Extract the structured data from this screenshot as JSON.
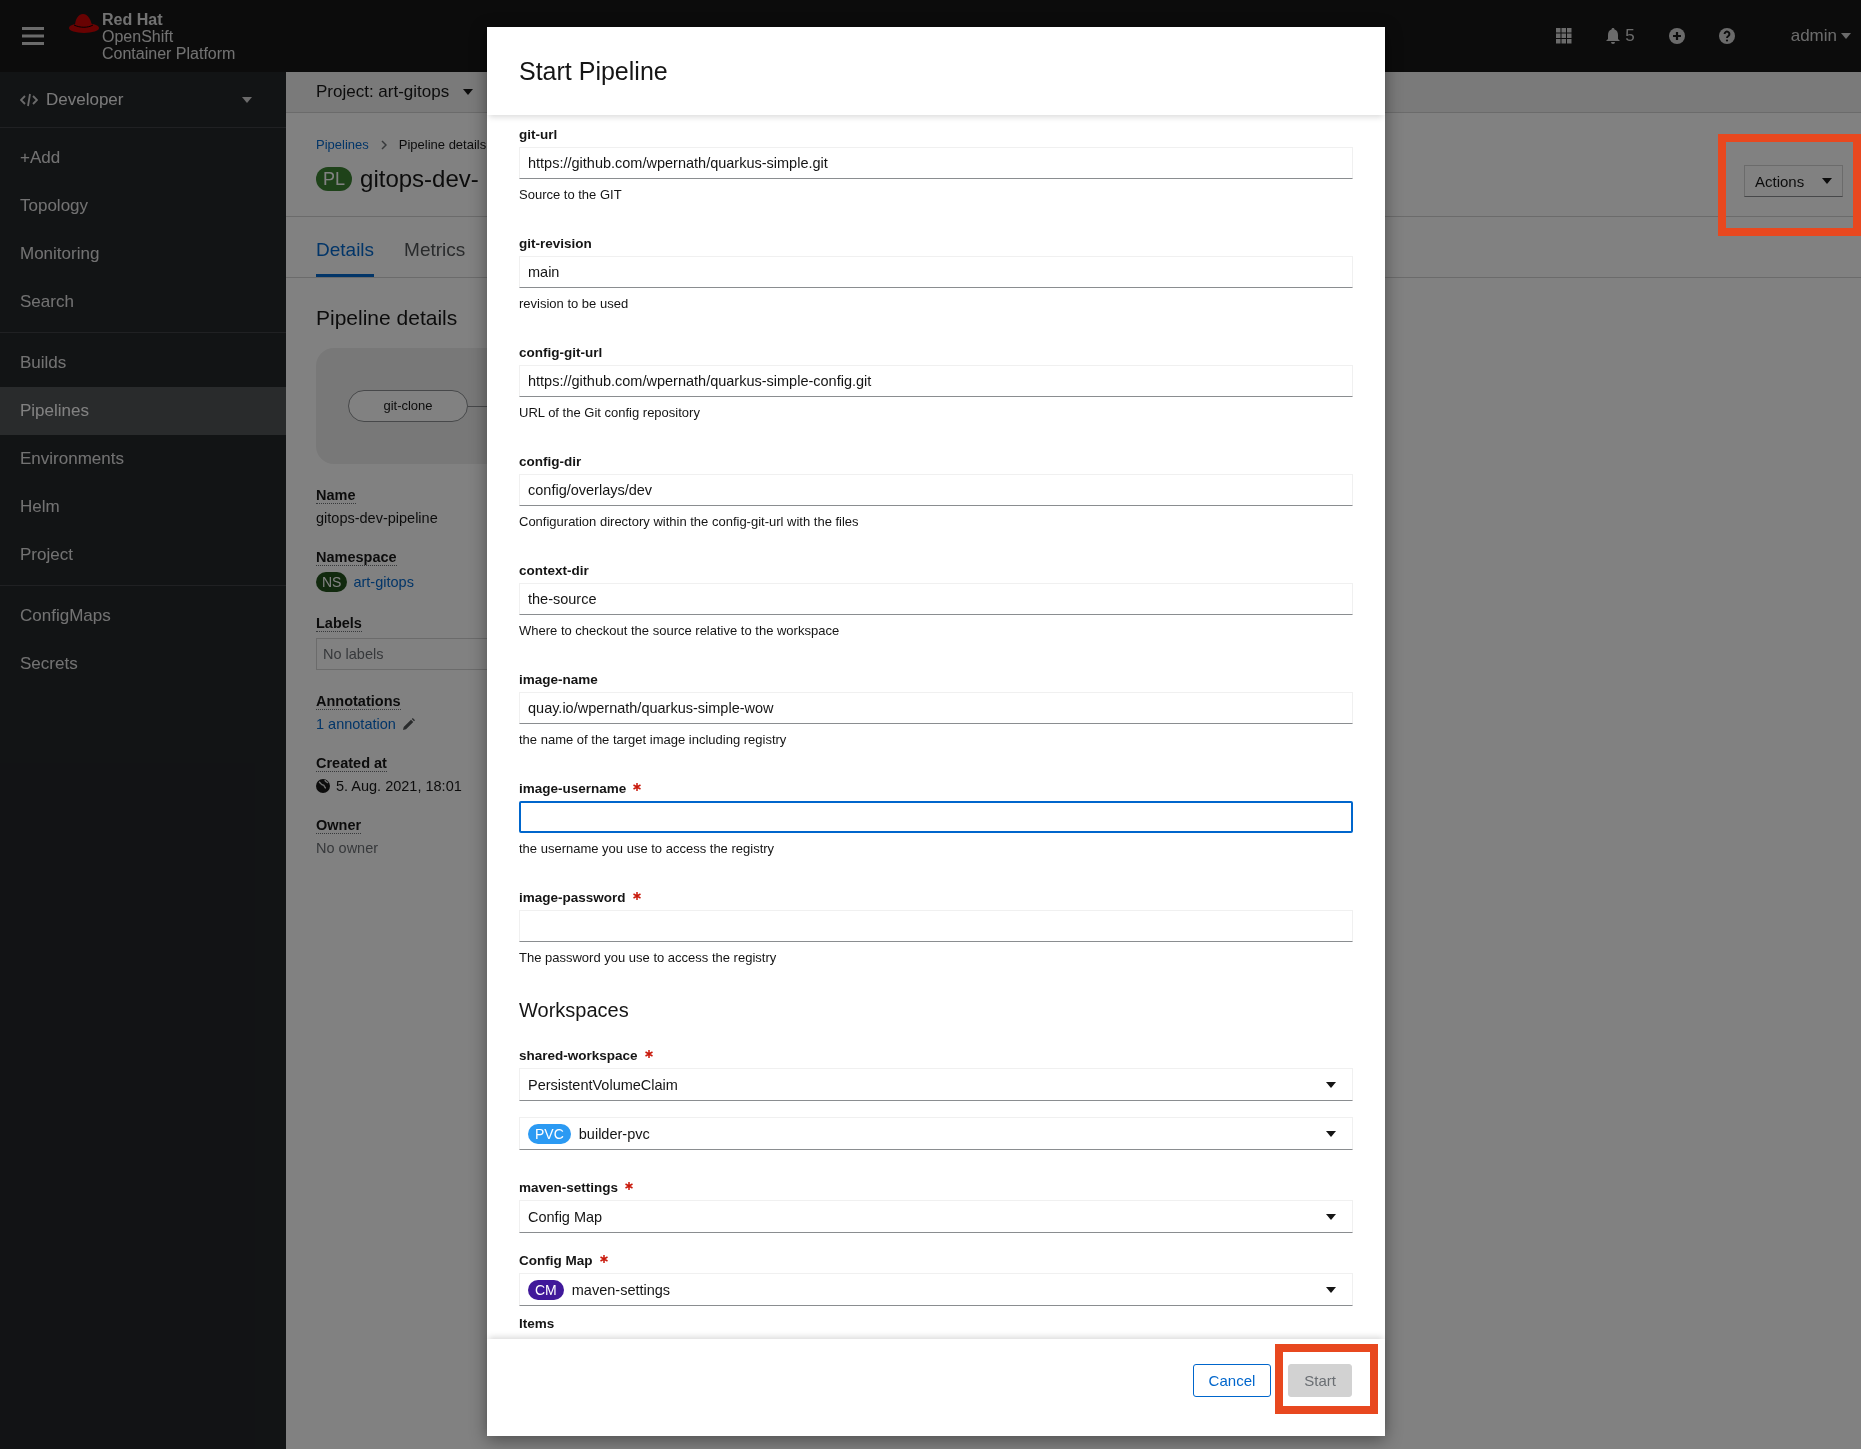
{
  "masthead": {
    "brand": [
      "Red Hat",
      "OpenShift",
      "Container Platform"
    ],
    "notifications": "5",
    "user": "admin"
  },
  "sidebar": {
    "perspective": "Developer",
    "groups": [
      [
        {
          "label": "+Add",
          "selected": false
        },
        {
          "label": "Topology",
          "selected": false
        },
        {
          "label": "Monitoring",
          "selected": false
        },
        {
          "label": "Search",
          "selected": false
        }
      ],
      [
        {
          "label": "Builds",
          "selected": false
        },
        {
          "label": "Pipelines",
          "selected": true
        },
        {
          "label": "Environments",
          "selected": false
        },
        {
          "label": "Helm",
          "selected": false
        },
        {
          "label": "Project",
          "selected": false
        }
      ],
      [
        {
          "label": "ConfigMaps",
          "selected": false
        },
        {
          "label": "Secrets",
          "selected": false
        }
      ]
    ]
  },
  "project_bar": {
    "label": "Project: art-gitops"
  },
  "breadcrumb": [
    {
      "label": "Pipelines",
      "kind": "link"
    },
    {
      "label": "Pipeline details",
      "kind": "current"
    }
  ],
  "title": {
    "badge": "PL",
    "text": "gitops-dev-"
  },
  "actions": {
    "label": "Actions",
    "highlighted": true
  },
  "tabs": [
    {
      "label": "Details",
      "selected": true
    },
    {
      "label": "Metrics",
      "selected": false
    }
  ],
  "section_title": "Pipeline details",
  "pipeline_graph": {
    "tasks": [
      "git-clone"
    ]
  },
  "details": [
    {
      "kind": "text",
      "label": "Name",
      "value": "gitops-dev-pipeline"
    },
    {
      "kind": "badge-link",
      "label": "Namespace",
      "badge": "NS",
      "value": "art-gitops"
    },
    {
      "kind": "box",
      "label": "Labels",
      "placeholder": "No labels"
    },
    {
      "kind": "edit-link",
      "label": "Annotations",
      "value": "1 annotation"
    },
    {
      "kind": "timestamp",
      "label": "Created at",
      "value": "5. Aug. 2021, 18:01"
    },
    {
      "kind": "muted",
      "label": "Owner",
      "value": "No owner"
    }
  ],
  "modal": {
    "title": "Start Pipeline",
    "parameters": [
      {
        "name": "git-url",
        "required": false,
        "focused": false,
        "value": "https://github.com/wpernath/quarkus-simple.git",
        "help": "Source to the GIT"
      },
      {
        "name": "git-revision",
        "required": false,
        "focused": false,
        "value": "main",
        "help": "revision to be used"
      },
      {
        "name": "config-git-url",
        "required": false,
        "focused": false,
        "value": "https://github.com/wpernath/quarkus-simple-config.git",
        "help": "URL of the Git config repository"
      },
      {
        "name": "config-dir",
        "required": false,
        "focused": false,
        "value": "config/overlays/dev",
        "help": "Configuration directory within the config-git-url with the files"
      },
      {
        "name": "context-dir",
        "required": false,
        "focused": false,
        "value": "the-source",
        "help": "Where to checkout the source relative to the workspace"
      },
      {
        "name": "image-name",
        "required": false,
        "focused": false,
        "value": "quay.io/wpernath/quarkus-simple-wow",
        "help": "the name of the target image including registry"
      },
      {
        "name": "image-username",
        "required": true,
        "focused": true,
        "help": "the username you use to access the registry"
      },
      {
        "name": "image-password",
        "required": true,
        "focused": false,
        "help": "The password you use to access the registry"
      }
    ],
    "workspaces_title": "Workspaces",
    "workspaces": [
      {
        "kind": "workspace",
        "label": "shared-workspace",
        "required": true,
        "selects": [
          {
            "value": "PersistentVolumeClaim"
          },
          {
            "badge": "PVC",
            "color": "#2b9af3",
            "value": "builder-pvc"
          }
        ]
      },
      {
        "kind": "workspace",
        "label": "maven-settings",
        "required": true,
        "selects": [
          {
            "value": "Config Map"
          }
        ]
      },
      {
        "kind": "subfield",
        "label": "Config Map",
        "required": true,
        "selects": [
          {
            "badge": "CM",
            "color": "#40199a",
            "value": "maven-settings"
          }
        ]
      }
    ],
    "items_label": "Items",
    "buttons": [
      {
        "label": "Cancel",
        "kind": "secondary",
        "disabled": false,
        "highlighted": false
      },
      {
        "label": "Start",
        "kind": "primary",
        "disabled": true,
        "highlighted": true
      }
    ]
  }
}
